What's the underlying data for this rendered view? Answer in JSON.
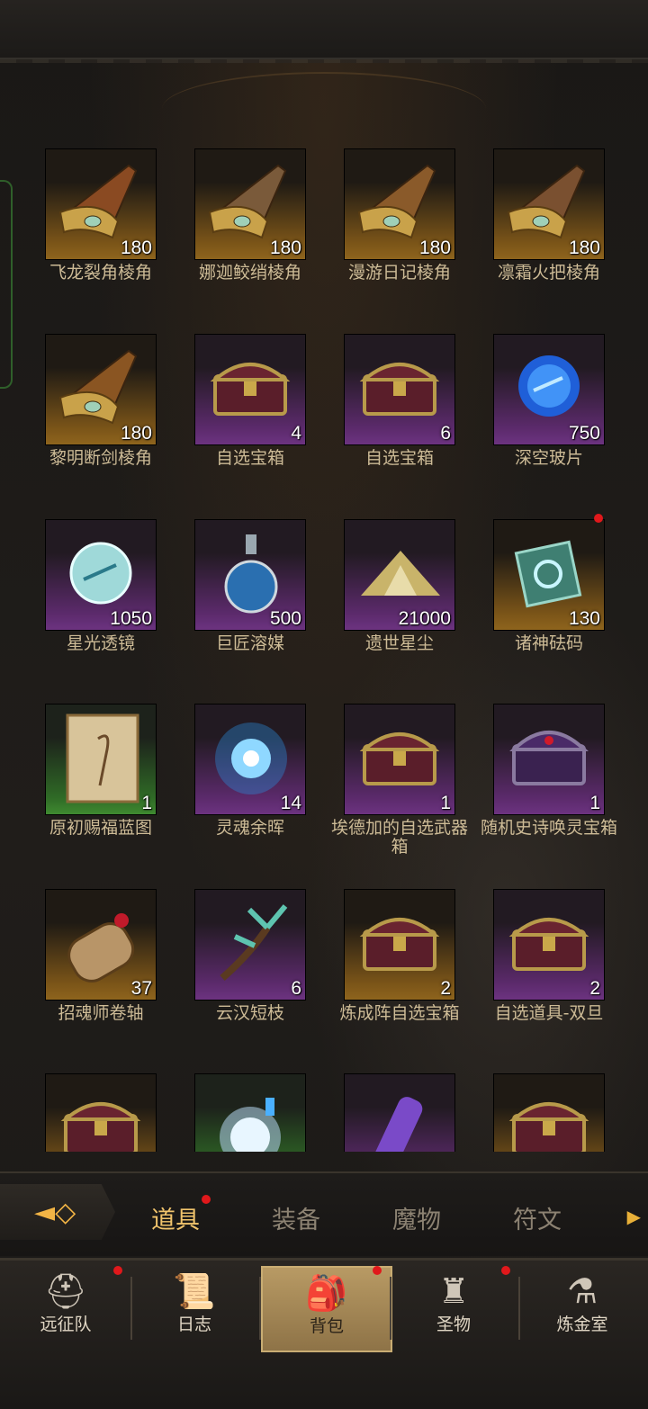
{
  "inventory": {
    "rows": [
      [
        {
          "name": "飞龙裂角棱角",
          "count": "180",
          "rarity": "gold",
          "icon": "horn-icon",
          "tint": "#8a4a22"
        },
        {
          "name": "娜迦鲛绡棱角",
          "count": "180",
          "rarity": "gold",
          "icon": "horn-icon",
          "tint": "#7a5a3a"
        },
        {
          "name": "漫游日记棱角",
          "count": "180",
          "rarity": "gold",
          "icon": "horn-icon",
          "tint": "#8a5a2a"
        },
        {
          "name": "凛霜火把棱角",
          "count": "180",
          "rarity": "gold",
          "icon": "horn-icon",
          "tint": "#7a5030"
        }
      ],
      [
        {
          "name": "黎明断剑棱角",
          "count": "180",
          "rarity": "gold",
          "icon": "horn-icon",
          "tint": "#8a5522"
        },
        {
          "name": "自选宝箱",
          "count": "4",
          "rarity": "purple",
          "icon": "chest-icon"
        },
        {
          "name": "自选宝箱",
          "count": "6",
          "rarity": "purple",
          "icon": "chest-icon"
        },
        {
          "name": "深空玻片",
          "count": "750",
          "rarity": "purple",
          "icon": "blue-orb-icon"
        }
      ],
      [
        {
          "name": "星光透镜",
          "count": "1050",
          "rarity": "purple",
          "icon": "crystal-orb-icon"
        },
        {
          "name": "巨匠溶媒",
          "count": "500",
          "rarity": "purple",
          "icon": "potion-icon"
        },
        {
          "name": "遗世星尘",
          "count": "21000",
          "rarity": "purple",
          "icon": "stardust-icon"
        },
        {
          "name": "诸神砝码",
          "count": "130",
          "rarity": "gold",
          "icon": "cube-icon",
          "dot": true
        }
      ],
      [
        {
          "name": "原初赐福蓝图",
          "count": "1",
          "rarity": "green",
          "icon": "scroll-icon"
        },
        {
          "name": "灵魂余晖",
          "count": "14",
          "rarity": "purple",
          "icon": "soul-icon"
        },
        {
          "name": "埃德加的自选武器箱",
          "count": "1",
          "rarity": "purple",
          "icon": "chest-icon"
        },
        {
          "name": "随机史诗唤灵宝箱",
          "count": "1",
          "rarity": "purple",
          "icon": "epic-chest-icon"
        }
      ],
      [
        {
          "name": "招魂师卷轴",
          "count": "37",
          "rarity": "gold",
          "icon": "scroll-roll-icon"
        },
        {
          "name": "云汉短枝",
          "count": "6",
          "rarity": "purple",
          "icon": "branch-icon"
        },
        {
          "name": "炼成阵自选宝箱",
          "count": "2",
          "rarity": "gold",
          "icon": "chest-icon"
        },
        {
          "name": "自选道具-双旦",
          "count": "2",
          "rarity": "purple",
          "icon": "chest-icon"
        }
      ],
      [
        {
          "name": "",
          "count": "",
          "rarity": "gold",
          "icon": "chest-icon"
        },
        {
          "name": "",
          "count": "",
          "rarity": "green",
          "icon": "orb-potion-icon"
        },
        {
          "name": "",
          "count": "",
          "rarity": "purple",
          "icon": "crystal-vial-icon"
        },
        {
          "name": "",
          "count": "",
          "rarity": "gold",
          "icon": "chest-icon"
        }
      ]
    ]
  },
  "tabs": {
    "items": [
      "道具",
      "装备",
      "魔物",
      "符文"
    ],
    "active": 0
  },
  "nav": {
    "items": [
      {
        "label": "远征队",
        "icon": "viking-helmet-icon",
        "dot": true
      },
      {
        "label": "日志",
        "icon": "journal-icon",
        "dot": false
      },
      {
        "label": "背包",
        "icon": "backpack-icon",
        "dot": true,
        "active": true
      },
      {
        "label": "圣物",
        "icon": "relic-icon",
        "dot": true
      },
      {
        "label": "炼金室",
        "icon": "alchemy-icon",
        "dot": false
      }
    ]
  },
  "colors": {
    "accent": "#f1c46c",
    "badge": "#e0181b",
    "gold_bg": "#8e641d",
    "purple_bg": "#6c3380",
    "green_bg": "#3f8a30"
  }
}
